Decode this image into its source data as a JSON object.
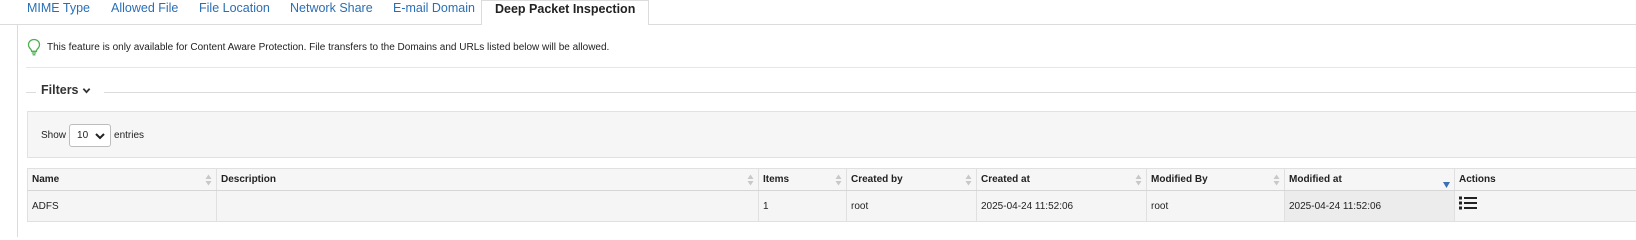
{
  "tabs": [
    {
      "label": "MIME Type"
    },
    {
      "label": "Allowed File"
    },
    {
      "label": "File Location"
    },
    {
      "label": "Network Share"
    },
    {
      "label": "E-mail Domain"
    },
    {
      "label": "Deep Packet Inspection",
      "active": true
    }
  ],
  "info": {
    "icon": "lightbulb-icon",
    "text": "This feature is only available for Content Aware Protection. File transfers to the Domains and URLs listed below will be allowed."
  },
  "filters": {
    "label": "Filters",
    "icon": "chevron-down-icon"
  },
  "length_control": {
    "show_label": "Show",
    "selected": "10",
    "entries_label": "entries"
  },
  "table": {
    "columns": [
      {
        "label": "Name",
        "sortable": true
      },
      {
        "label": "Description",
        "sortable": true
      },
      {
        "label": "Items",
        "sortable": true
      },
      {
        "label": "Created by",
        "sortable": true
      },
      {
        "label": "Created at",
        "sortable": true
      },
      {
        "label": "Modified By",
        "sortable": true
      },
      {
        "label": "Modified at",
        "sortable": true,
        "sorted": "desc"
      },
      {
        "label": "Actions",
        "sortable": false
      }
    ],
    "rows": [
      {
        "name": "ADFS",
        "description": "",
        "items": "1",
        "created_by": "root",
        "created_at": "2025-04-24 11:52:06",
        "modified_by": "root",
        "modified_at": "2025-04-24 11:52:06",
        "actions_icon": "list-icon"
      }
    ]
  },
  "colors": {
    "link": "#2a6fb5",
    "bulb": "#4caf50",
    "sort_active": "#3b6fb6",
    "sort_inactive": "#c8c8c8"
  }
}
